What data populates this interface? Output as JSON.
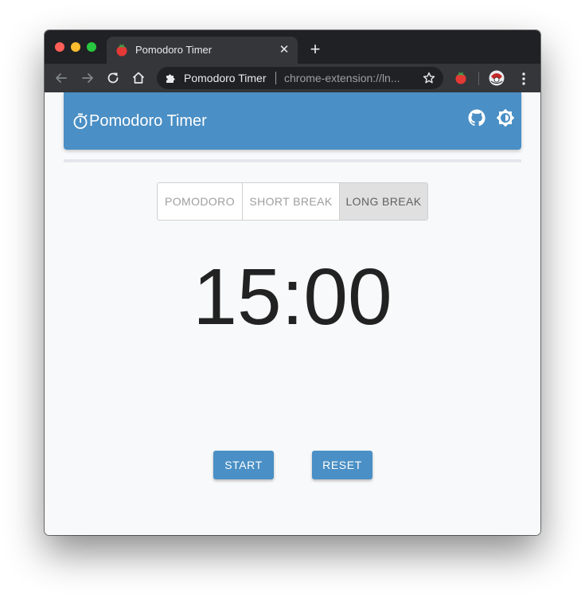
{
  "browser": {
    "tab": {
      "title": "Pomodoro Timer",
      "favicon": "tomato-icon",
      "close_glyph": "✕"
    },
    "new_tab_glyph": "+",
    "toolbar": {
      "omnibox": {
        "chip_label": "Pomodoro Timer",
        "url": "chrome-extension://ln..."
      }
    }
  },
  "app": {
    "header": {
      "title": "Pomodoro Timer",
      "icons": [
        "timer-icon",
        "github-icon",
        "brightness-icon"
      ],
      "color": "#4a8fc5"
    },
    "progress": 0,
    "modes": [
      {
        "label": "POMODORO",
        "selected": false
      },
      {
        "label": "SHORT BREAK",
        "selected": false
      },
      {
        "label": "LONG BREAK",
        "selected": true
      }
    ],
    "timer": "15:00",
    "buttons": {
      "start": "START",
      "reset": "RESET"
    }
  }
}
